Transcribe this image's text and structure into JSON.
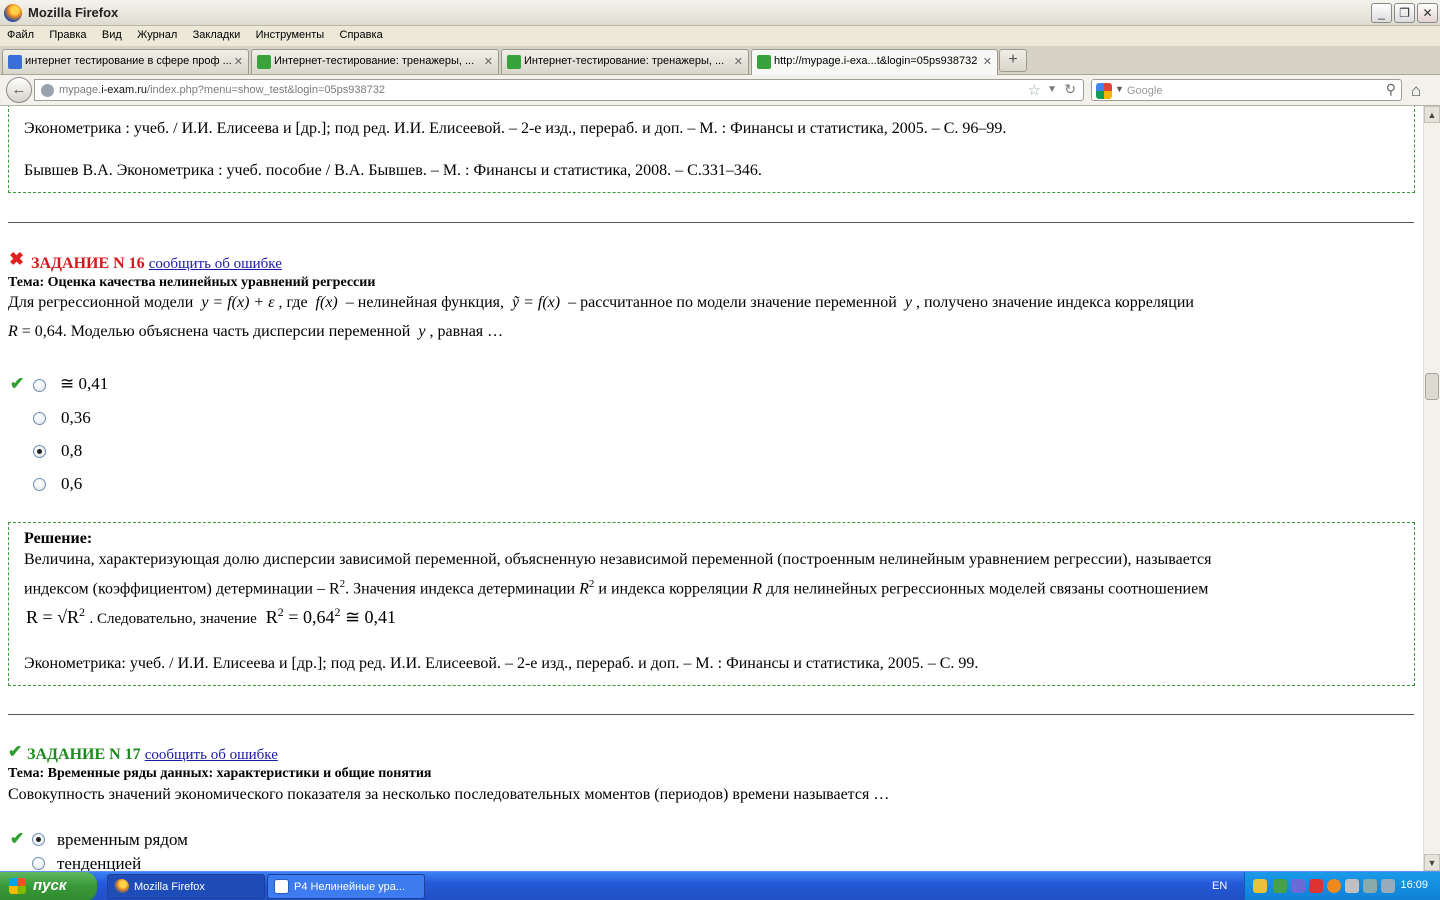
{
  "window": {
    "title": "Mozilla Firefox"
  },
  "menu": [
    "Файл",
    "Правка",
    "Вид",
    "Журнал",
    "Закладки",
    "Инструменты",
    "Справка"
  ],
  "tabs": [
    {
      "label": "интернет тестирование в сфере проф ...",
      "icon": "google-icon",
      "color": "#3b6fd8"
    },
    {
      "label": "Интернет-тестирование: тренажеры, ...",
      "icon": "page-icon",
      "color": "#37a33a"
    },
    {
      "label": "Интернет-тестирование: тренажеры, ...",
      "icon": "page-icon",
      "color": "#37a33a"
    },
    {
      "label": "http://mypage.i-exa...t&login=05ps938732",
      "icon": "page-icon",
      "color": "#37a33a"
    }
  ],
  "nav": {
    "url_prefix": "mypage.",
    "url_domain": "i-exam.ru",
    "url_rest": "/index.php?menu=show_test&login=05ps938732",
    "search_placeholder": "Google"
  },
  "top_box": {
    "ref1": "Эконометрика : учеб. / И.И. Елисеева и [др.]; под ред. И.И. Елисеевой. – 2-е изд., перераб. и доп. – М. : Финансы и статистика, 2005. – С. 96–99.",
    "ref2": "Бывшев В.А. Эконометрика : учеб. пособие / В.А. Бывшев. – М. : Финансы и статистика, 2008. – С.331–346."
  },
  "task16": {
    "title": "ЗАДАНИЕ N 16",
    "report": "сообщить об ошибке",
    "topic": "Тема: Оценка качества нелинейных уравнений регрессии",
    "q_part1": "Для регрессионной модели",
    "q_formula1": "y = f(x) + ε",
    "q_part2": ", где",
    "q_formula2": "f(x)",
    "q_part3": "– нелинейная функция,",
    "q_formula3": "ỹ = f(x)",
    "q_part4": "– рассчитанное по модели значение переменной",
    "q_var": "y",
    "q_part5": ", получено значение индекса корреляции",
    "q_line2_r": "R",
    "q_line2_rest": "= 0,64. Моделью объяснена часть дисперсии переменной",
    "q_line2_tail": ", равная …",
    "options": [
      "≅ 0,41",
      "0,36",
      "0,8",
      "0,6"
    ],
    "selected_index": 2,
    "correct_index": 0,
    "solution_title": "Решение:",
    "sol_line1": "Величина, характеризующая долю дисперсии зависимой переменной, объясненную независимой переменной (построенным нелинейным уравнением регрессии), называется",
    "sol_line2a": "индексом (коэффициентом) детерминации – R",
    "sol_line2b": ". Значения индекса детерминации",
    "sol_line2c": "и индекса корреляции",
    "sol_line2d": "для нелинейных регрессионных моделей связаны соотношением",
    "sol_formula_a": "R = √R",
    "sol_line3": ". Следовательно, значение",
    "sol_formula_b": "R",
    "sol_formula_b_rest": "= 0,64",
    "sol_formula_b_end": "≅ 0,41",
    "sol_ref": "Эконометрика: учеб. / И.И. Елисеева и [др.]; под ред. И.И. Елисеевой. – 2-е изд., перераб. и доп. – М. : Финансы и статистика, 2005. – С. 99."
  },
  "task17": {
    "title": "ЗАДАНИЕ N 17",
    "report": "сообщить об ошибке",
    "topic": "Тема: Временные ряды данных: характеристики и общие понятия",
    "question": "Совокупность значений экономического показателя за несколько последовательных моментов (периодов) времени называется …",
    "options": [
      "временным рядом",
      "тенденцией"
    ],
    "selected_index": 0,
    "correct_index": 0
  },
  "taskbar": {
    "start": "пуск",
    "items": [
      "Mozilla Firefox",
      "P4 Нелинейные ура..."
    ],
    "lang": "EN",
    "clock": "16:09"
  }
}
